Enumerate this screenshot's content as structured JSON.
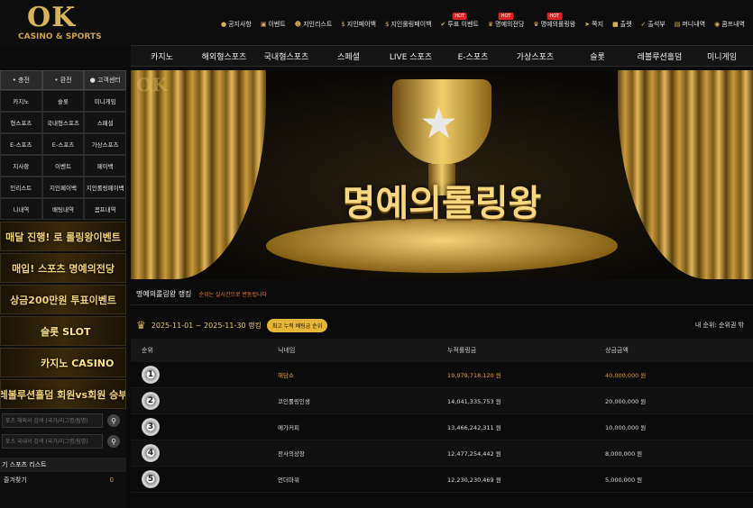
{
  "brand": {
    "logo": "OK",
    "tagline": "CASINO & SPORTS"
  },
  "top_menu": [
    {
      "label": "공지사항",
      "icon": "info-icon",
      "hot": ""
    },
    {
      "label": "이벤트",
      "icon": "calendar-icon",
      "hot": ""
    },
    {
      "label": "지인리스트",
      "icon": "people-icon",
      "hot": ""
    },
    {
      "label": "지인페이백",
      "icon": "money-icon",
      "hot": ""
    },
    {
      "label": "지인롤링페이백",
      "icon": "money-icon",
      "hot": ""
    },
    {
      "label": "투표 이벤트",
      "icon": "vote-icon",
      "hot": "HOT"
    },
    {
      "label": "명예의전당",
      "icon": "trophy-icon",
      "hot": "HOT"
    },
    {
      "label": "명예의롤링왕",
      "icon": "trophy-icon",
      "hot": "HOT"
    },
    {
      "label": "쪽지",
      "icon": "send-icon",
      "hot": ""
    },
    {
      "label": "출렛",
      "icon": "gift-icon",
      "hot": ""
    },
    {
      "label": "출석부",
      "icon": "check-icon",
      "hot": ""
    },
    {
      "label": "머니내역",
      "icon": "wallet-icon",
      "hot": ""
    },
    {
      "label": "콤프내역",
      "icon": "coin-icon",
      "hot": ""
    }
  ],
  "main_nav": [
    "카지노",
    "해외형스포츠",
    "국내형스포츠",
    "스페셜",
    "LIVE 스포츠",
    "E-스포츠",
    "가상스포츠",
    "슬롯",
    "레볼루션홀덤",
    "미니게임"
  ],
  "sidebar": {
    "auth": [
      "• 충전",
      "• 환전",
      "● 고객센터"
    ],
    "grid": [
      "카지노",
      "슬롯",
      "미니게임",
      "형스포츠",
      "국내형스포츠",
      "스페셜",
      "E-스포츠",
      "E-스포츠",
      "가상스포츠",
      "지사항",
      "이벤트",
      "페이백",
      "인리스트",
      "지인페이백",
      "지인롤링페이백",
      "니내역",
      "배팅내역",
      "콤프내역"
    ],
    "banners": [
      "매달 진행! 로 롤링왕이벤트",
      "매입! 스포츠 명예의전당",
      "상금200만원 투표이벤트",
      "슬롯 SLOT",
      "카지노 CASINO",
      "레볼루션홀덤 회원vs회원 승부"
    ],
    "search1_placeholder": "포츠 해외서 검색 (국가/리그명/팀명)",
    "search2_placeholder": "포츠 국내서 검색 (국가/리그명/팀명)",
    "sports_list": "기 스포츠 리스트",
    "favorites": "즐겨찾기",
    "favorites_count": "0"
  },
  "hero": {
    "logo": "OK",
    "title": "명예의롤링왕"
  },
  "ranking": {
    "title": "명예의롤링왕 랭킹",
    "note": "순위는 실시간으로 변동됩니다",
    "period": "2025-11-01 ~ 2025-11-30 랭킹",
    "pill": "최고 누적 배팅금 순위",
    "my_rank": "내 순위: 순위권 밖",
    "headers": [
      "순위",
      "닉네임",
      "누적롤링금",
      "상금금액"
    ],
    "rows": [
      {
        "rank": "1",
        "nick": "해담쇼",
        "rolling": "19,979,718,120 원",
        "prize": "40,000,000 원"
      },
      {
        "rank": "2",
        "nick": "코인롤링인생",
        "rolling": "14,041,335,753 원",
        "prize": "20,000,000 원"
      },
      {
        "rank": "3",
        "nick": "메가커피",
        "rolling": "13,466,242,311 원",
        "prize": "10,000,000 원"
      },
      {
        "rank": "4",
        "nick": "전사의상장",
        "rolling": "12,477,254,442 원",
        "prize": "8,000,000 원"
      },
      {
        "rank": "5",
        "nick": "언더마워",
        "rolling": "12,230,230,469 원",
        "prize": "5,000,000 원"
      }
    ]
  }
}
